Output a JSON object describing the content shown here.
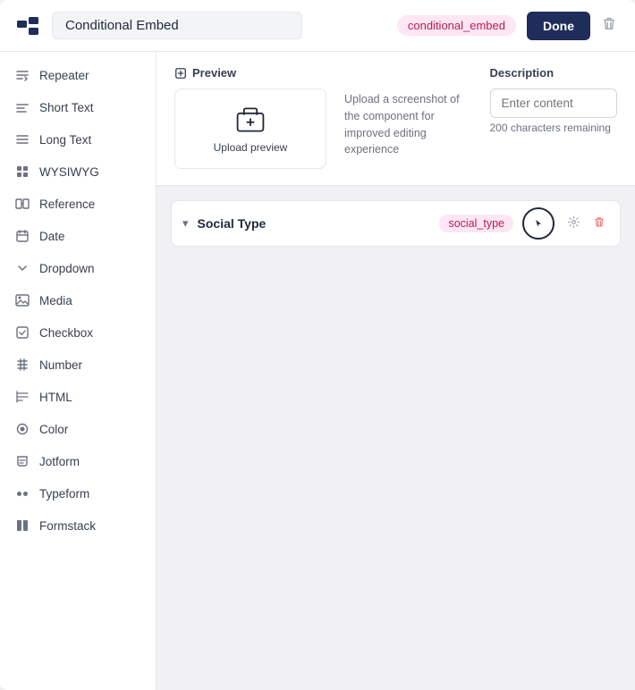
{
  "topBar": {
    "logo_alt": "logo",
    "title": "Conditional Embed",
    "badge": "conditional_embed",
    "done_label": "Done",
    "delete_label": "🗑"
  },
  "previewSection": {
    "preview_label": "Preview",
    "upload_label": "Upload preview",
    "description_label": "Description",
    "description_placeholder": "Enter content",
    "description_chars": "200 characters remaining",
    "upload_desc": "Upload a screenshot of the component for improved editing experience"
  },
  "sidebar": {
    "items": [
      {
        "id": "repeater",
        "label": "Repeater",
        "icon": "repeater-icon"
      },
      {
        "id": "short-text",
        "label": "Short Text",
        "icon": "short-text-icon"
      },
      {
        "id": "long-text",
        "label": "Long Text",
        "icon": "long-text-icon"
      },
      {
        "id": "wysiwyg",
        "label": "WYSIWYG",
        "icon": "wysiwyg-icon"
      },
      {
        "id": "reference",
        "label": "Reference",
        "icon": "reference-icon"
      },
      {
        "id": "date",
        "label": "Date",
        "icon": "date-icon"
      },
      {
        "id": "dropdown",
        "label": "Dropdown",
        "icon": "dropdown-icon"
      },
      {
        "id": "media",
        "label": "Media",
        "icon": "media-icon"
      },
      {
        "id": "checkbox",
        "label": "Checkbox",
        "icon": "checkbox-icon"
      },
      {
        "id": "number",
        "label": "Number",
        "icon": "number-icon"
      },
      {
        "id": "html",
        "label": "HTML",
        "icon": "html-icon"
      },
      {
        "id": "color",
        "label": "Color",
        "icon": "color-icon"
      },
      {
        "id": "jotform",
        "label": "Jotform",
        "icon": "jotform-icon"
      },
      {
        "id": "typeform",
        "label": "Typeform",
        "icon": "typeform-icon"
      },
      {
        "id": "formstack",
        "label": "Formstack",
        "icon": "formstack-icon"
      }
    ]
  },
  "fields": [
    {
      "name": "Social Type",
      "key": "social_type",
      "has_chevron": true
    }
  ]
}
